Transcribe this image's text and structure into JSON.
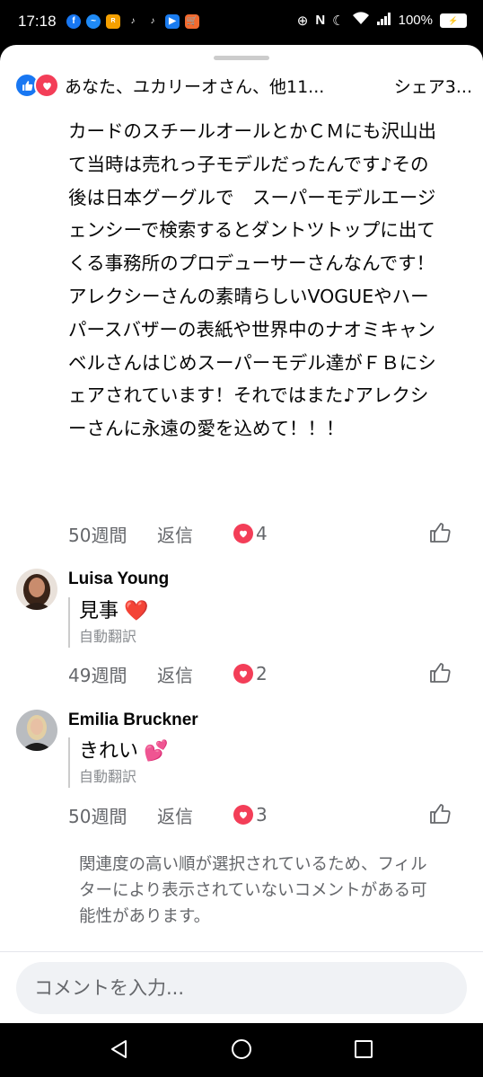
{
  "status_bar": {
    "time": "17:18",
    "battery": "100%",
    "notification_icons": [
      "facebook-icon",
      "messenger-icon",
      "rakuten-icon",
      "tiktok-icon",
      "tiktok-icon",
      "youtube-icon",
      "shopping-icon"
    ],
    "system_icons": [
      "add-circle-icon",
      "nfc-icon",
      "moon-icon",
      "wifi-icon",
      "signal-icon",
      "battery-icon"
    ]
  },
  "header": {
    "reactions_text": "あなた、ユカリーオさん、他11...",
    "shares_text": "シェア3..."
  },
  "main_comment": {
    "text": "カードのスチールオールとかＣＭにも沢山出て当時は売れっ子モデルだったんです♪その後は日本グーグルで　スーパーモデルエージェンシーで検索するとダントツトップに出てくる事務所のプロデューサーさんなんです！アレクシーさんの素晴らしいVOGUEやハーパースバザーの表紙や世界中のナオミキャンベルさんはじめスーパーモデル達がＦＢにシェアされています！それではまた♪アレクシーさんに永遠の愛を込めて！！！",
    "time_ago": "50週間",
    "reply_label": "返信",
    "reaction_count": "4"
  },
  "replies": [
    {
      "author": "Luisa Young",
      "text": "見事",
      "emoji": "❤️",
      "translated_label": "自動翻訳",
      "time_ago": "49週間",
      "reply_label": "返信",
      "reaction_count": "2"
    },
    {
      "author": "Emilia Bruckner",
      "text": "きれい",
      "emoji": "💕",
      "translated_label": "自動翻訳",
      "time_ago": "50週間",
      "reply_label": "返信",
      "reaction_count": "3"
    }
  ],
  "filter_note": "関連度の高い順が選択されているため、フィルターにより表示されていないコメントがある可能性があります。",
  "comment_input": {
    "placeholder": "コメントを入力..."
  },
  "colors": {
    "like_blue": "#1877f2",
    "love_red": "#f33e58",
    "secondary_text": "#65676b"
  }
}
